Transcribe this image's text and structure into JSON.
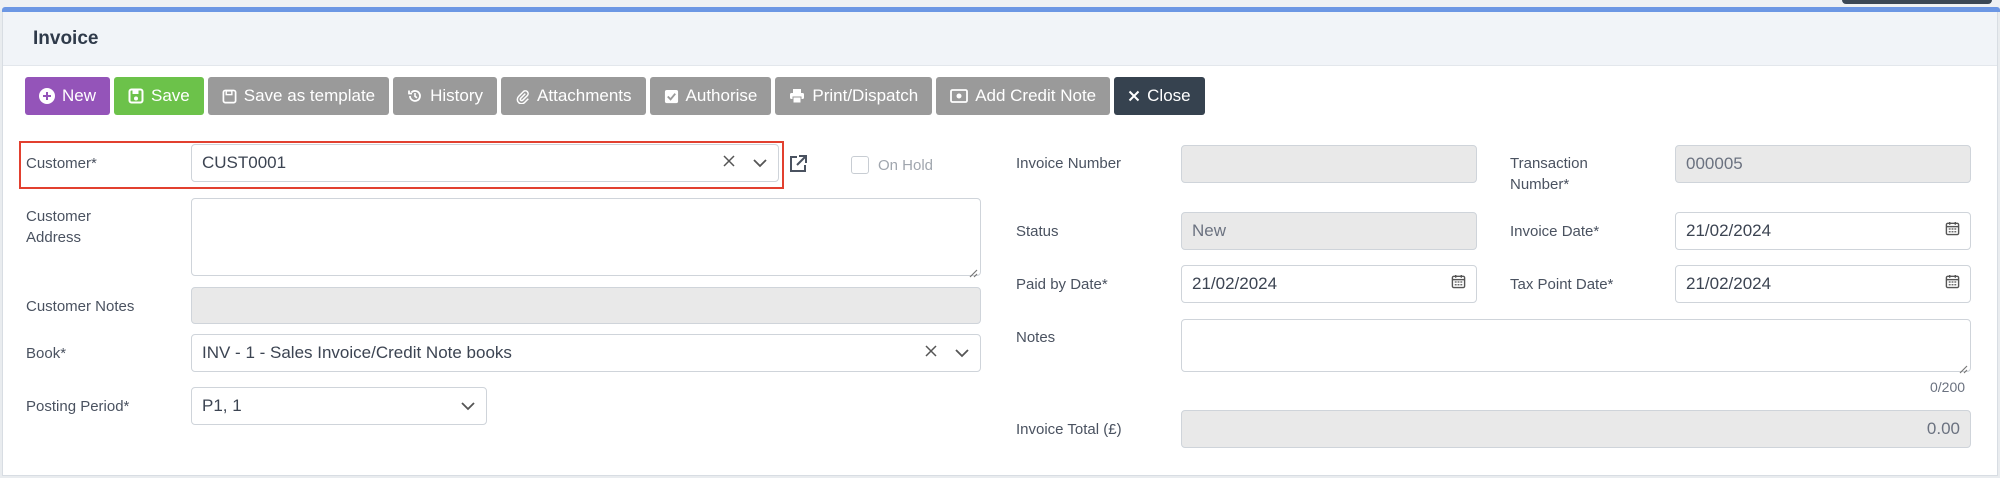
{
  "header": {
    "title": "Invoice"
  },
  "toolbar": {
    "new": "New",
    "save": "Save",
    "save_template": "Save as template",
    "history": "History",
    "attachments": "Attachments",
    "authorise": "Authorise",
    "print": "Print/Dispatch",
    "credit_note": "Add Credit Note",
    "close": "Close"
  },
  "left": {
    "customer_label": "Customer*",
    "customer_value": "CUST0001",
    "on_hold_label": "On Hold",
    "address_label_1": "Customer",
    "address_label_2": "Address",
    "address_value": "",
    "notes_label": "Customer Notes",
    "notes_value": "",
    "book_label": "Book*",
    "book_value": "INV - 1 - Sales Invoice/Credit Note books",
    "period_label": "Posting Period*",
    "period_value": "P1, 1"
  },
  "middle": {
    "invoice_number_label": "Invoice Number",
    "invoice_number_value": "",
    "status_label": "Status",
    "status_value": "New",
    "paid_by_label": "Paid by Date*",
    "paid_by_value": "21/02/2024",
    "notes_label": "Notes",
    "notes_value": "",
    "notes_counter": "0/200",
    "total_label": "Invoice Total (£)",
    "total_value": "0.00"
  },
  "right": {
    "transaction_label_1": "Transaction",
    "transaction_label_2": "Number*",
    "transaction_value": "000005",
    "invoice_date_label": "Invoice Date*",
    "invoice_date_value": "21/02/2024",
    "tax_point_label": "Tax Point Date*",
    "tax_point_value": "21/02/2024"
  }
}
